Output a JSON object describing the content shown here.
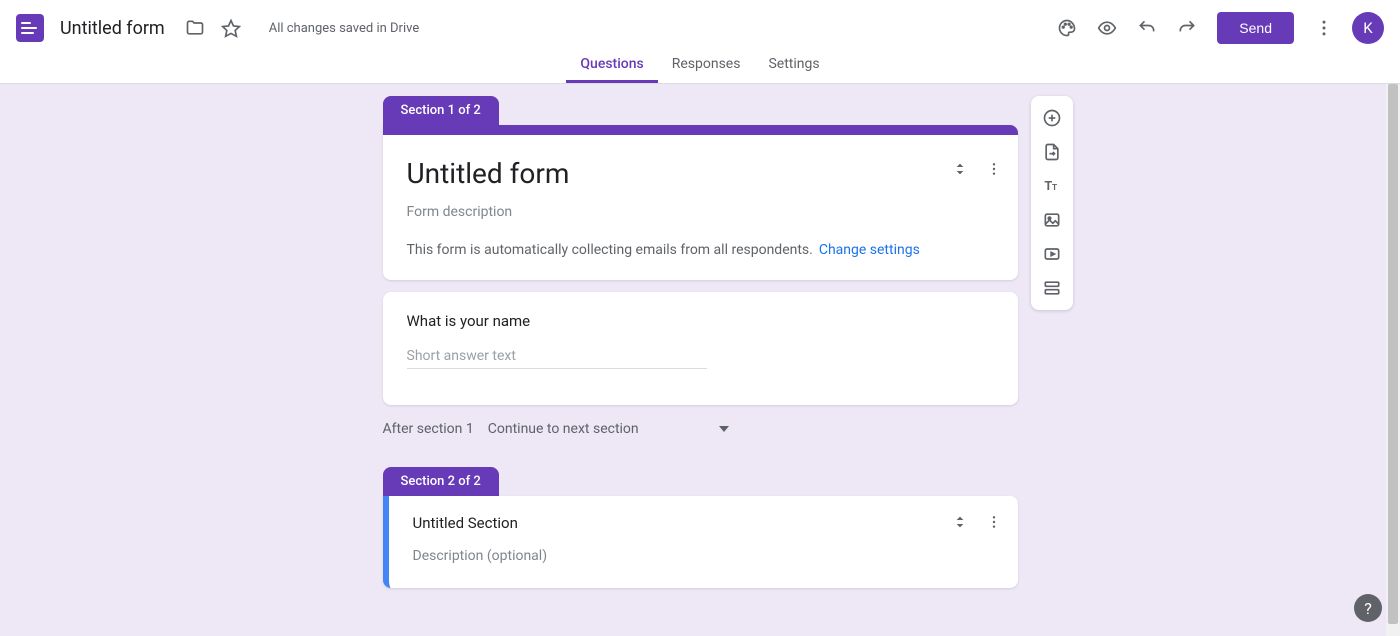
{
  "header": {
    "doc_title": "Untitled form",
    "save_status": "All changes saved in Drive",
    "send_label": "Send",
    "avatar_initial": "K"
  },
  "tabs": {
    "questions": "Questions",
    "responses": "Responses",
    "settings": "Settings"
  },
  "section1": {
    "badge": "Section 1 of 2",
    "title": "Untitled form",
    "description_placeholder": "Form description",
    "collect_text": "This form is automatically collecting emails from all respondents.",
    "collect_link": "Change settings"
  },
  "question1": {
    "title": "What is your name",
    "answer_placeholder": "Short answer text"
  },
  "after_section": {
    "label": "After section 1",
    "selection": "Continue to next section"
  },
  "section2": {
    "badge": "Section 2 of 2",
    "title": "Untitled Section",
    "description_placeholder": "Description (optional)"
  },
  "toolbar": {
    "icons": [
      "add-question",
      "import-questions",
      "add-title",
      "add-image",
      "add-video",
      "add-section"
    ]
  },
  "colors": {
    "theme": "#673ab7",
    "canvas": "#ede7f6",
    "link": "#1a73e8"
  }
}
